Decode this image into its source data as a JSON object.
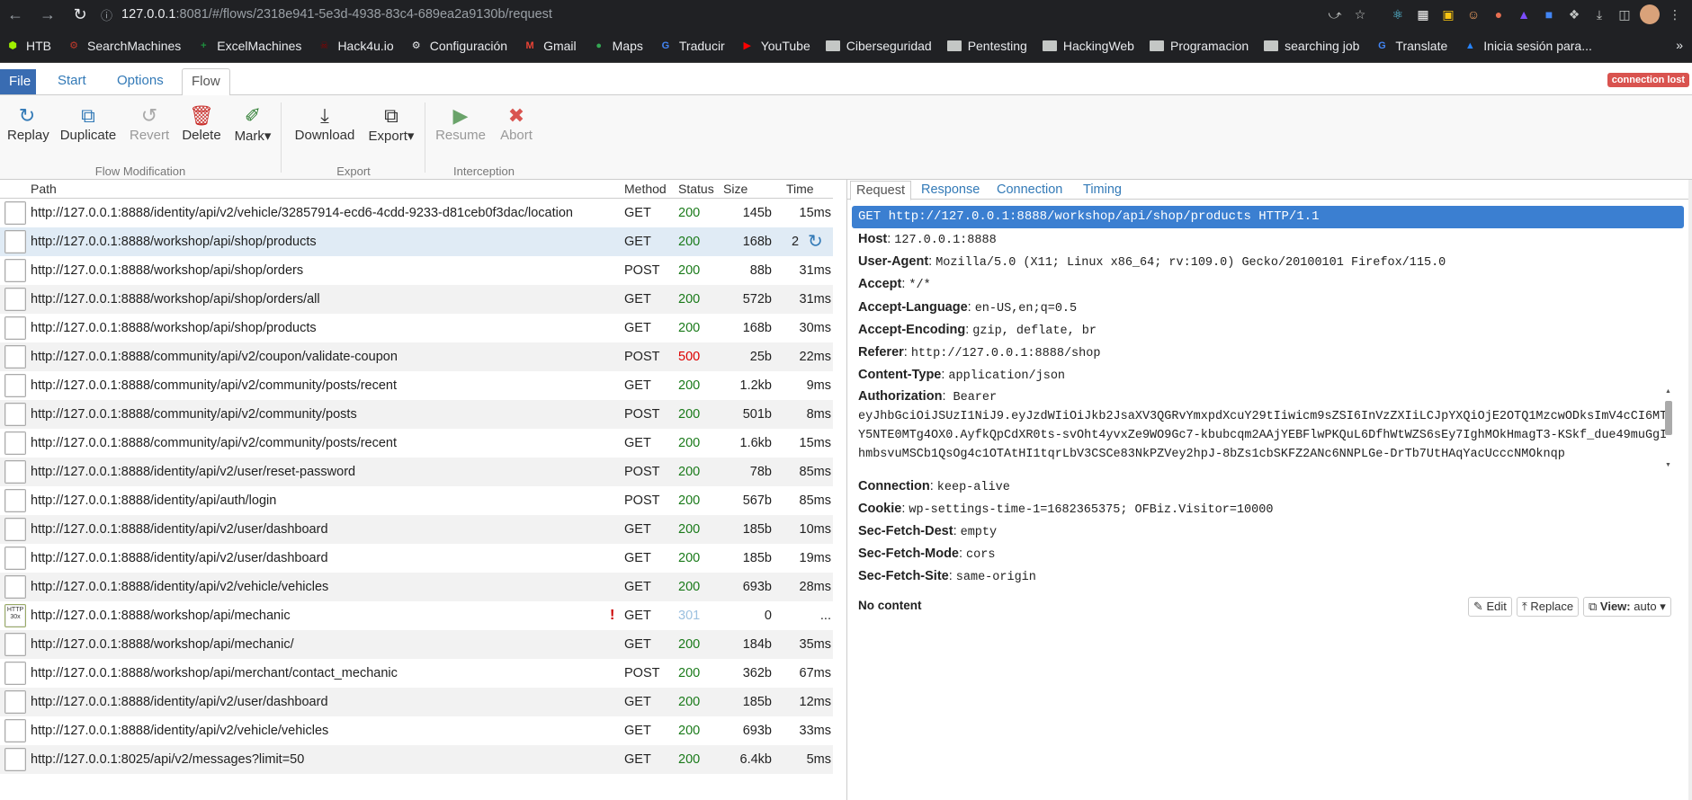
{
  "browser": {
    "url_host": "127.0.0.1",
    "url_rest": ":8081/#/flows/2318e941-5e3d-4938-83c4-689ea2a9130b/request",
    "bookmarks": [
      {
        "label": "HTB",
        "icon": "cube-icon",
        "color": "#9fef00"
      },
      {
        "label": "SearchMachines",
        "icon": "gear-icon",
        "color": "#c0392b"
      },
      {
        "label": "ExcelMachines",
        "icon": "plus-icon",
        "color": "#1e8e3e"
      },
      {
        "label": "Hack4u.io",
        "icon": "skull-icon",
        "color": "#8b0000"
      },
      {
        "label": "Configuración",
        "icon": "gear-icon",
        "color": "#e8eaed"
      },
      {
        "label": "Gmail",
        "icon": "gmail-icon",
        "color": "#ea4335"
      },
      {
        "label": "Maps",
        "icon": "maps-icon",
        "color": "#34a853"
      },
      {
        "label": "Traducir",
        "icon": "translate-icon",
        "color": "#4285f4"
      },
      {
        "label": "YouTube",
        "icon": "youtube-icon",
        "color": "#ff0000"
      },
      {
        "label": "Ciberseguridad",
        "icon": "folder-icon"
      },
      {
        "label": "Pentesting",
        "icon": "folder-icon"
      },
      {
        "label": "HackingWeb",
        "icon": "folder-icon"
      },
      {
        "label": "Programacion",
        "icon": "folder-icon"
      },
      {
        "label": "searching job",
        "icon": "folder-icon"
      },
      {
        "label": "Translate",
        "icon": "translate-icon",
        "color": "#4285f4"
      },
      {
        "label": "Inicia sesión para...",
        "icon": "atlassian-icon",
        "color": "#2684ff"
      }
    ],
    "bookmarks_more": "»"
  },
  "menu": {
    "tabs": [
      "File",
      "Start",
      "Options",
      "Flow"
    ],
    "status_badge": "connection lost"
  },
  "toolbar": {
    "buttons": {
      "replay": "Replay",
      "duplicate": "Duplicate",
      "revert": "Revert",
      "delete": "Delete",
      "mark": "Mark▾",
      "download": "Download",
      "export": "Export▾",
      "resume": "Resume",
      "abort": "Abort"
    },
    "groups": {
      "flow_modification": "Flow Modification",
      "export": "Export",
      "interception": "Interception"
    }
  },
  "flows": {
    "columns": {
      "path": "Path",
      "method": "Method",
      "status": "Status",
      "size": "Size",
      "time": "Time"
    },
    "rows": [
      {
        "path": "http://127.0.0.1:8888/identity/api/v2/vehicle/32857914-ecd6-4cdd-9233-d81ceb0f3dac/location",
        "method": "GET",
        "status": "200",
        "size": "145b",
        "time": "15ms"
      },
      {
        "path": "http://127.0.0.1:8888/workshop/api/shop/products",
        "method": "GET",
        "status": "200",
        "size": "168b",
        "time": "2",
        "selected": true
      },
      {
        "path": "http://127.0.0.1:8888/workshop/api/shop/orders",
        "method": "POST",
        "status": "200",
        "size": "88b",
        "time": "31ms"
      },
      {
        "path": "http://127.0.0.1:8888/workshop/api/shop/orders/all",
        "method": "GET",
        "status": "200",
        "size": "572b",
        "time": "31ms"
      },
      {
        "path": "http://127.0.0.1:8888/workshop/api/shop/products",
        "method": "GET",
        "status": "200",
        "size": "168b",
        "time": "30ms"
      },
      {
        "path": "http://127.0.0.1:8888/community/api/v2/coupon/validate-coupon",
        "method": "POST",
        "status": "500",
        "size": "25b",
        "time": "22ms"
      },
      {
        "path": "http://127.0.0.1:8888/community/api/v2/community/posts/recent",
        "method": "GET",
        "status": "200",
        "size": "1.2kb",
        "time": "9ms"
      },
      {
        "path": "http://127.0.0.1:8888/community/api/v2/community/posts",
        "method": "POST",
        "status": "200",
        "size": "501b",
        "time": "8ms"
      },
      {
        "path": "http://127.0.0.1:8888/community/api/v2/community/posts/recent",
        "method": "GET",
        "status": "200",
        "size": "1.6kb",
        "time": "15ms"
      },
      {
        "path": "http://127.0.0.1:8888/identity/api/v2/user/reset-password",
        "method": "POST",
        "status": "200",
        "size": "78b",
        "time": "85ms"
      },
      {
        "path": "http://127.0.0.1:8888/identity/api/auth/login",
        "method": "POST",
        "status": "200",
        "size": "567b",
        "time": "85ms"
      },
      {
        "path": "http://127.0.0.1:8888/identity/api/v2/user/dashboard",
        "method": "GET",
        "status": "200",
        "size": "185b",
        "time": "10ms"
      },
      {
        "path": "http://127.0.0.1:8888/identity/api/v2/user/dashboard",
        "method": "GET",
        "status": "200",
        "size": "185b",
        "time": "19ms"
      },
      {
        "path": "http://127.0.0.1:8888/identity/api/v2/vehicle/vehicles",
        "method": "GET",
        "status": "200",
        "size": "693b",
        "time": "28ms"
      },
      {
        "path": "http://127.0.0.1:8888/workshop/api/mechanic",
        "method": "GET",
        "status": "301",
        "size": "0",
        "time": "...",
        "icon_label": "HTTP 30x",
        "warn": "!"
      },
      {
        "path": "http://127.0.0.1:8888/workshop/api/mechanic/",
        "method": "GET",
        "status": "200",
        "size": "184b",
        "time": "35ms"
      },
      {
        "path": "http://127.0.0.1:8888/workshop/api/merchant/contact_mechanic",
        "method": "POST",
        "status": "200",
        "size": "362b",
        "time": "67ms"
      },
      {
        "path": "http://127.0.0.1:8888/identity/api/v2/user/dashboard",
        "method": "GET",
        "status": "200",
        "size": "185b",
        "time": "12ms"
      },
      {
        "path": "http://127.0.0.1:8888/identity/api/v2/vehicle/vehicles",
        "method": "GET",
        "status": "200",
        "size": "693b",
        "time": "33ms"
      },
      {
        "path": "http://127.0.0.1:8025/api/v2/messages?limit=50",
        "method": "GET",
        "status": "200",
        "size": "6.4kb",
        "time": "5ms"
      }
    ]
  },
  "detail": {
    "tabs": [
      "Request",
      "Response",
      "Connection",
      "Timing"
    ],
    "request_line": "GET http://127.0.0.1:8888/workshop/api/shop/products HTTP/1.1",
    "headers_top": [
      {
        "name": "Host",
        "value": "127.0.0.1:8888"
      },
      {
        "name": "User-Agent",
        "value": "Mozilla/5.0 (X11; Linux x86_64; rv:109.0) Gecko/20100101 Firefox/115.0"
      },
      {
        "name": "Accept",
        "value": "*/*"
      },
      {
        "name": "Accept-Language",
        "value": "en-US,en;q=0.5"
      },
      {
        "name": "Accept-Encoding",
        "value": "gzip, deflate, br"
      },
      {
        "name": "Referer",
        "value": "http://127.0.0.1:8888/shop"
      },
      {
        "name": "Content-Type",
        "value": "application/json"
      }
    ],
    "authorization": {
      "name": "Authorization",
      "value": "Bearer eyJhbGciOiJSUzI1NiJ9.eyJzdWIiOiJkb2JsaXV3QGRvYmxpdXcuY29tIiwicm9sZSI6InVzZXIiLCJpYXQiOjE2OTQ1MzcwODksImV4cCI6MTY5NTE0MTg4OX0.AyfkQpCdXR0ts-svOht4yvxZe9WO9Gc7-kbubcqm2AAjYEBFlwPKQuL6DfhWtWZS6sEy7IghMOkHmagT3-KSkf_due49muGgIhmbsvuMSCb1QsOg4c1OTAtHI1tqrLbV3CSCe83NkPZVey2hpJ-8bZs1cbSKFZ2ANc6NNPLGe-DrTb7UtHAqYacUcccNMOknqp"
    },
    "headers_bottom": [
      {
        "name": "Connection",
        "value": "keep-alive"
      },
      {
        "name": "Cookie",
        "value": "wp-settings-time-1=1682365375; OFBiz.Visitor=10000"
      },
      {
        "name": "Sec-Fetch-Dest",
        "value": "empty"
      },
      {
        "name": "Sec-Fetch-Mode",
        "value": "cors"
      },
      {
        "name": "Sec-Fetch-Site",
        "value": "same-origin"
      }
    ],
    "no_content": "No content",
    "buttons": {
      "edit": "Edit",
      "replace": "Replace",
      "view_label": "View:",
      "view_value": "auto"
    }
  }
}
